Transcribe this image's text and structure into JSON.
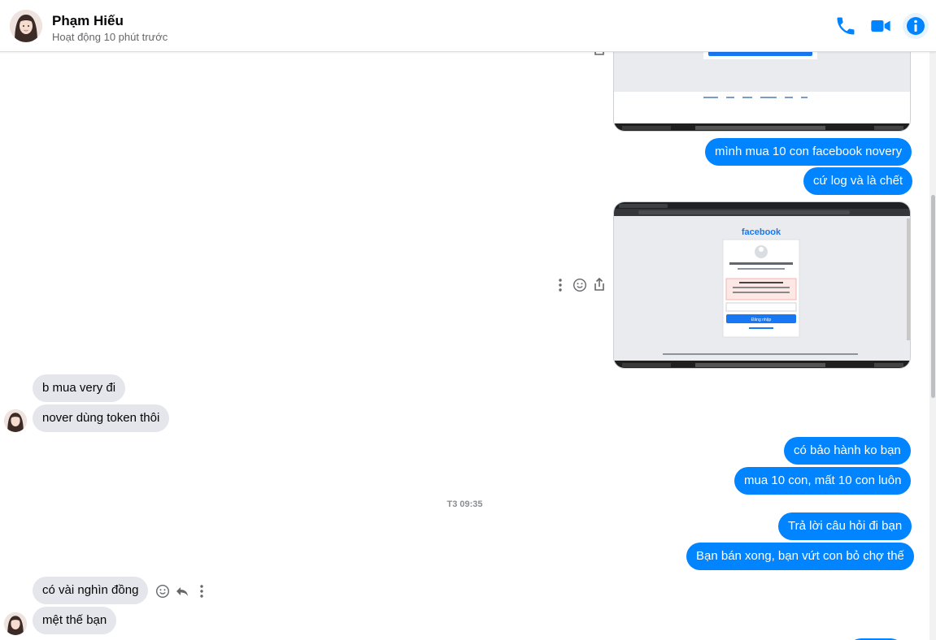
{
  "header": {
    "contact_name": "Phạm Hiếu",
    "status": "Hoạt động 10 phút trước",
    "icons": [
      "phone-icon",
      "video-camera-icon",
      "info-icon"
    ],
    "accent_color": "#0084ff"
  },
  "messages": {
    "out_1": "mình mua 10 con facebook novery",
    "out_2": "cứ log và là chết",
    "in_1": "b mua very đi",
    "in_2": "nover dùng token thôi",
    "out_3": "có bảo hành ko bạn",
    "out_4": "mua 10 con, mất 10 con luôn",
    "timestamp": "T3 09:35",
    "out_5": "Trả lời câu hỏi đi bạn",
    "out_6": "Bạn bán xong, bạn vứt con bỏ chợ thế",
    "in_3": "có vài nghìn đồng",
    "in_4": "mệt thế bạn"
  },
  "screenshot_2": {
    "brand": "facebook",
    "login_button": "Đăng nhập"
  },
  "colors": {
    "outgoing_bubble": "#0084ff",
    "incoming_bubble": "#e4e6eb"
  }
}
